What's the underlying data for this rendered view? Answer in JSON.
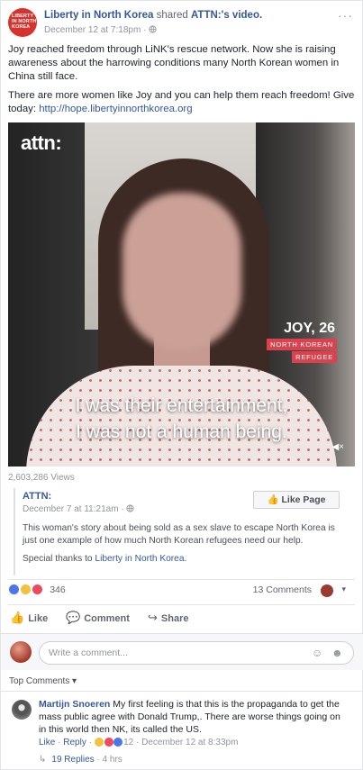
{
  "post": {
    "page_logo_text": "LIBERTY IN NORTH KOREA",
    "page_name": "Liberty in North Korea",
    "shared_text": " shared ",
    "shared_source": "ATTN:'s video.",
    "date": "December 12 at 7:18pm",
    "globe": "·",
    "more": "···",
    "paragraph1": "Joy reached freedom through LiNK's rescue network. Now she is raising awareness about the harrowing conditions many North Korean women in China still face.",
    "paragraph2_prefix": "There are more women like Joy and you can help them reach freedom! Give today: ",
    "paragraph2_link": "http://hope.libertyinnorthkorea.org"
  },
  "video": {
    "brand": "attn:",
    "person_name": "JOY, 26",
    "tag_line1": "NORTH KOREAN",
    "tag_line2": "REFUGEE",
    "caption_line1": "I was their entertainment,",
    "caption_line2": "I was not a human being.",
    "mute_icon": "◀×",
    "views": "2,603,286 Views"
  },
  "shared_post": {
    "name": "ATTN:",
    "date": "December 7 at 11:21am · ",
    "like_page_label": "Like Page",
    "text": "This woman's story about being sold as a sex slave to escape North Korea is just one example of how much North Korean refugees need our help.",
    "thanks_prefix": "Special thanks to ",
    "thanks_link": "Liberty in North Korea",
    "thanks_suffix": "."
  },
  "stats": {
    "reaction_count": "346",
    "comments": "13 Comments",
    "caret": "▾"
  },
  "actions": {
    "like": "Like",
    "comment": "Comment",
    "share": "Share",
    "like_icon": "👍",
    "comment_icon": "💬",
    "share_icon": "↪"
  },
  "composer": {
    "placeholder": "Write a comment...",
    "emoji_icon": "☺",
    "sticker_icon": "☻"
  },
  "comments_section": {
    "top_comments_label": "Top Comments ▾"
  },
  "comment": {
    "author": "Martijn Snoeren",
    "text": " My first feeling is that this is the propaganda to get the mass public agree with Donald Trump,. There are worse things going on in this world then NK, its called the US.",
    "like": "Like",
    "reply": "Reply",
    "reaction_count": "12",
    "date": "December 12 at 8:33pm",
    "replies": "19 Replies",
    "replies_time": " · 4 hrs"
  },
  "colors": {
    "link": "#365899",
    "brand_red": "#d8322c",
    "tag_pink": "#d9434f"
  }
}
